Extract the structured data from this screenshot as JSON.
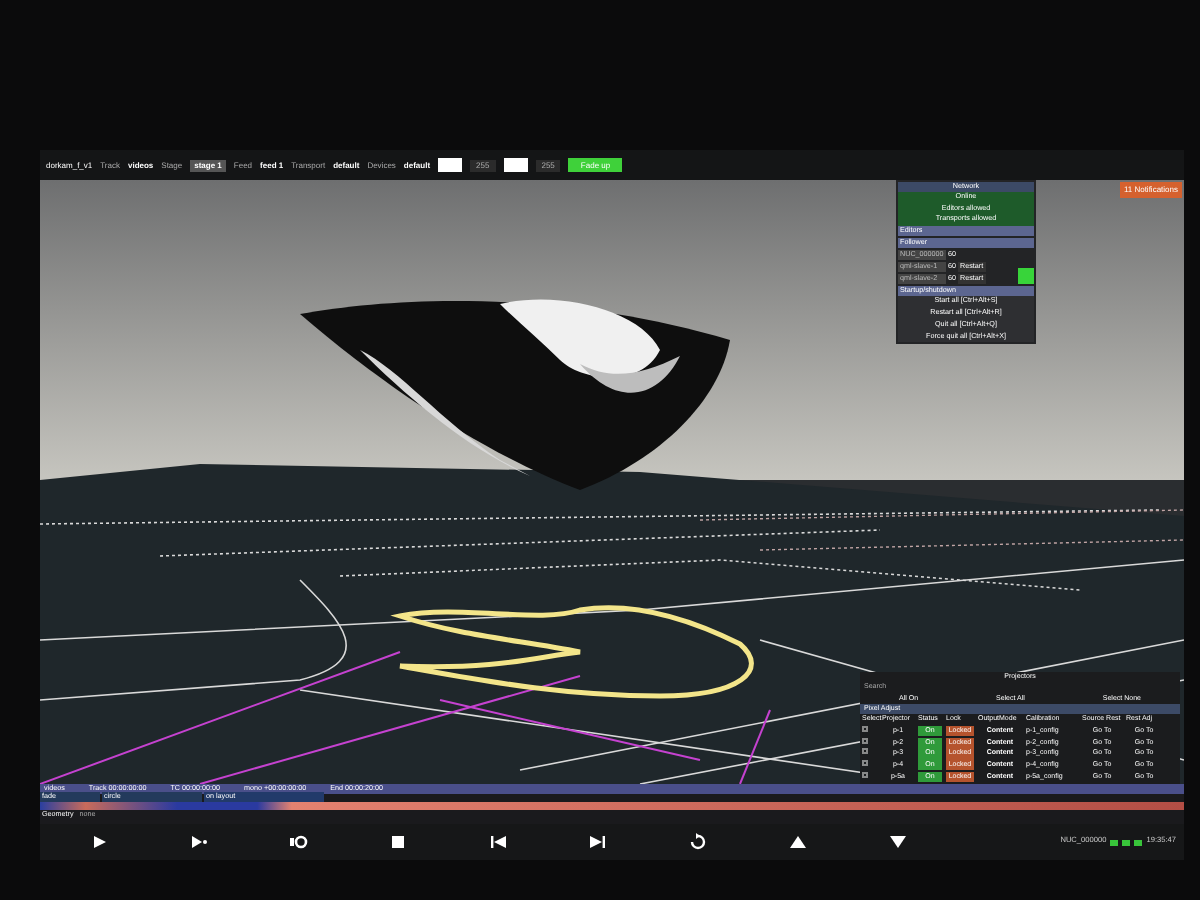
{
  "top_bar": {
    "project": "dorkam_f_v1",
    "fields": [
      {
        "label": "Track",
        "value": "videos",
        "selected": false
      },
      {
        "label": "Stage",
        "value": "stage 1",
        "selected": true
      },
      {
        "label": "Feed",
        "value": "feed 1",
        "selected": false
      },
      {
        "label": "Transport",
        "value": "default",
        "selected": false
      },
      {
        "label": "Devices",
        "value": "default",
        "selected": false
      }
    ],
    "swatches": [
      {
        "reading": "255"
      },
      {
        "reading": "255"
      }
    ],
    "fade_button": "Fade up"
  },
  "notifications": "11 Notifications",
  "network_panel": {
    "title": "Network",
    "status": [
      "Online",
      "Editors allowed",
      "Transports allowed"
    ],
    "editors_header": "Editors",
    "follower_header": "Follower",
    "followers": [
      {
        "name": "NUC_000000",
        "value": "60"
      },
      {
        "name": "qml-slave-1",
        "value": "60",
        "action": "Restart"
      },
      {
        "name": "qml-slave-2",
        "value": "60",
        "action": "Restart"
      }
    ],
    "startup_header": "Startup/shutdown",
    "commands": [
      "Start all [Ctrl+Alt+S]",
      "Restart all [Ctrl+Alt+R]",
      "Quit all [Ctrl+Alt+Q]",
      "Force quit all [Ctrl+Alt+X]"
    ]
  },
  "projectors_panel": {
    "title": "Projectors",
    "search": "Search",
    "buttons": [
      "All On",
      "Select All",
      "Select None"
    ],
    "section": "Pixel Adjust",
    "select_header": "Select",
    "columns": [
      "Projector",
      "Status",
      "Lock",
      "OutputMode",
      "Calibration",
      "Source Rest",
      "Rest Adj"
    ],
    "rows": [
      {
        "selected": false,
        "cells": [
          "p-1",
          "On",
          "Locked",
          "Content",
          "p-1_config",
          "Go To",
          "Go To"
        ]
      },
      {
        "selected": false,
        "cells": [
          "p-2",
          "On",
          "Locked",
          "Content",
          "p-2_config",
          "Go To",
          "Go To"
        ]
      },
      {
        "selected": false,
        "cells": [
          "p-3",
          "On",
          "Locked",
          "Content",
          "p-3_config",
          "Go To",
          "Go To"
        ]
      },
      {
        "selected": false,
        "cells": [
          "p-4",
          "On",
          "Locked",
          "Content",
          "p-4_config",
          "Go To",
          "Go To"
        ]
      },
      {
        "selected": false,
        "cells": [
          "p-5a",
          "On",
          "Locked",
          "Content",
          "p-5a_config",
          "Go To",
          "Go To"
        ]
      }
    ]
  },
  "timeline": {
    "track_name": "videos",
    "times": [
      "Track 00:00:00:00",
      "TC 00:00:00:00",
      "mono +00:00:00:00",
      "End 00:00:20:00"
    ],
    "clips": [
      "fade",
      "circle",
      "on layout"
    ],
    "geometry_label": "Geometry",
    "geometry_value": "none"
  },
  "transport": [
    {
      "kind": "play"
    },
    {
      "kind": "play_to"
    },
    {
      "kind": "loop"
    },
    {
      "kind": "stop"
    },
    {
      "kind": "previous"
    },
    {
      "kind": "next"
    },
    {
      "kind": "undo"
    },
    {
      "kind": "up"
    },
    {
      "kind": "down"
    }
  ],
  "status_bar": {
    "host": "NUC_000000",
    "time": "19:35:47"
  }
}
